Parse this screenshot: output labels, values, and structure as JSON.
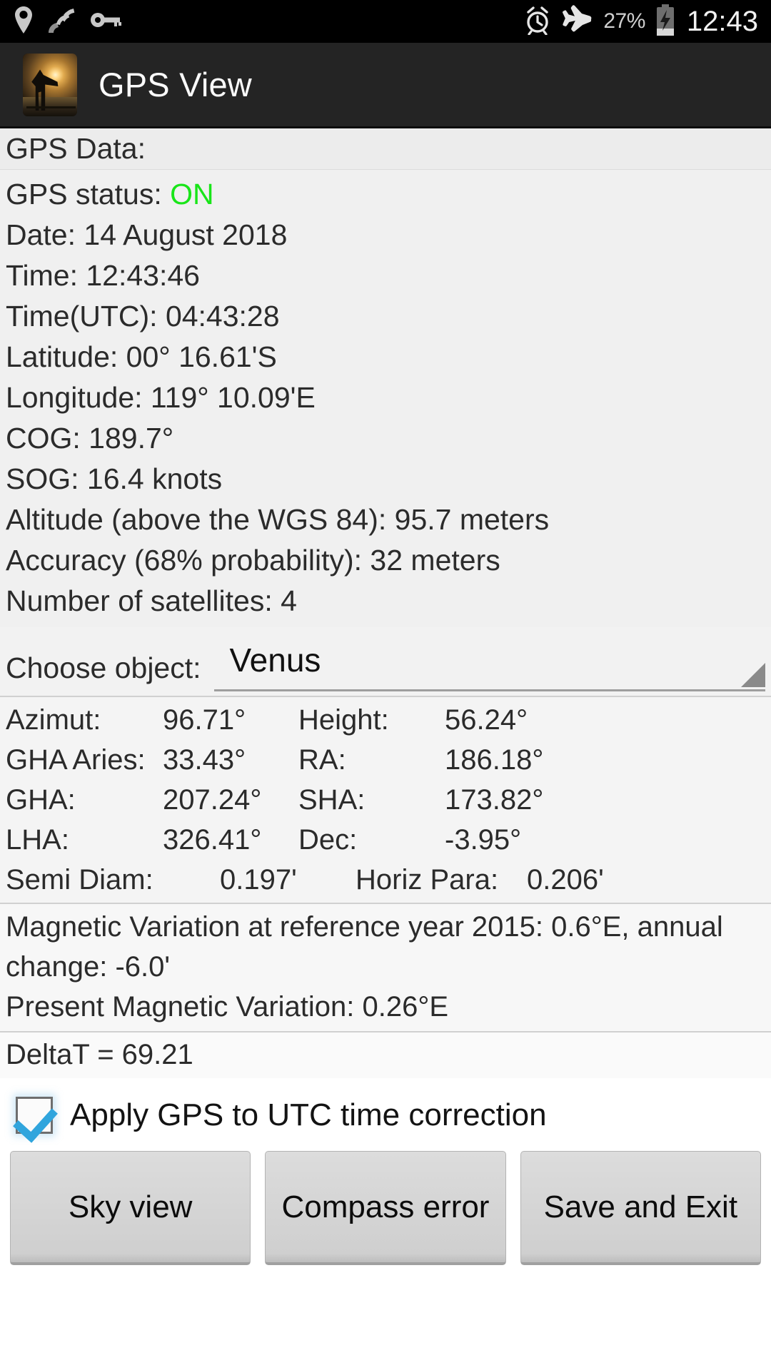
{
  "status_bar": {
    "icons_left": [
      "location-pin-icon",
      "gps-satellite-icon",
      "vpn-key-icon"
    ],
    "icons_right": [
      "alarm-clock-icon",
      "airplane-mode-icon",
      "battery-charging-icon"
    ],
    "battery_percent": "27%",
    "clock": "12:43"
  },
  "action_bar": {
    "app_icon": "gps-view-app-icon",
    "title": "GPS View"
  },
  "gps": {
    "header": "GPS Data:",
    "status_label": "GPS status: ",
    "status_value": "ON",
    "status_color": "#19e519",
    "lines": [
      "Date: 14 August 2018",
      "Time: 12:43:46",
      "Time(UTC): 04:43:28",
      "Latitude:   00° 16.61'S",
      "Longitude: 119° 10.09'E",
      "COG: 189.7°",
      "SOG: 16.4 knots",
      "Altitude (above the WGS 84): 95.7 meters",
      "Accuracy (68% probability): 32 meters",
      "Number of satellites: 4"
    ]
  },
  "choose_object": {
    "label": "Choose object:",
    "value": "Venus"
  },
  "astro": {
    "rows": [
      {
        "label1": "Azimut:",
        "value1": "96.71°",
        "label2": "Height:",
        "value2": "56.24°"
      },
      {
        "label1": "GHA Aries:",
        "value1": "33.43°",
        "label2": "RA:",
        "value2": "186.18°"
      },
      {
        "label1": "GHA:",
        "value1": "207.24°",
        "label2": "SHA:",
        "value2": "173.82°"
      },
      {
        "label1": "LHA:",
        "value1": "326.41°",
        "label2": "Dec:",
        "value2": "-3.95°"
      },
      {
        "label1": "Semi Diam:",
        "value1": "0.197'",
        "label2": "Horiz Para:",
        "value2": "0.206'"
      }
    ]
  },
  "magnetic": {
    "variation": "Magnetic Variation at reference year 2015: 0.6°E, annual change: -6.0'",
    "present": "Present Magnetic Variation: 0.26°E"
  },
  "delta_t": "DeltaT = 69.21",
  "checkbox": {
    "label": "Apply GPS to UTC time correction",
    "checked": true
  },
  "buttons": [
    {
      "label": "Sky view"
    },
    {
      "label": "Compass error"
    },
    {
      "label": "Save and Exit"
    }
  ]
}
